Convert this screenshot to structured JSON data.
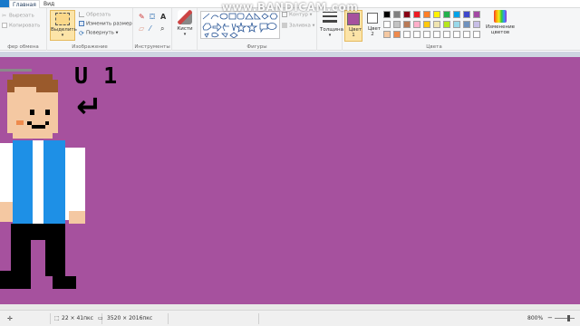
{
  "watermark": "www.BANDICAM.com",
  "tabs": [
    {
      "label": "",
      "active": false
    },
    {
      "label": "Главная",
      "active": true
    },
    {
      "label": "Вид",
      "active": false
    }
  ],
  "clipboard": {
    "cut": "Вырезать",
    "copy": "Копировать",
    "group": "фер обмена"
  },
  "image": {
    "select": "Выделить",
    "crop": "Обрезать",
    "resize": "Изменить размер",
    "rotate": "Повернуть",
    "group": "Изображение"
  },
  "tools": {
    "group": "Инструменты"
  },
  "brushes": {
    "label": "Кисти"
  },
  "shapes": {
    "outline": "Контур",
    "fill": "Заливка",
    "group": "Фигуры"
  },
  "size": {
    "label": "Толщина"
  },
  "colors": {
    "color1": "Цвет 1",
    "color2": "Цвет 2",
    "edit": "Изменение цветов",
    "group": "Цвета",
    "color1_value": "#a6519e",
    "color2_value": "#ffffff",
    "palette_row1": [
      "#000000",
      "#7f7f7f",
      "#880015",
      "#ed1c24",
      "#ff7f27",
      "#fff200",
      "#22b14c",
      "#00a2e8",
      "#3f48cc",
      "#a349a4"
    ],
    "palette_row2": [
      "#ffffff",
      "#c3c3c3",
      "#b97a57",
      "#ffaec9",
      "#ffc90e",
      "#efe4b0",
      "#b5e61d",
      "#99d9ea",
      "#7092be",
      "#c8bfe7"
    ],
    "palette_row3": [
      "#f4c8a2",
      "#ee8a4d",
      "#ffffff",
      "#ffffff",
      "#ffffff",
      "#ffffff",
      "#ffffff",
      "#ffffff",
      "#ffffff",
      "#ffffff"
    ],
    "canvas_bg": "#a6519e"
  },
  "canvas": {
    "text_line1": "U 1",
    "arrow": "↵"
  },
  "status": {
    "cursor": "22 × 41пкс",
    "size": "3520 × 2016пкс",
    "zoom": "800%"
  }
}
